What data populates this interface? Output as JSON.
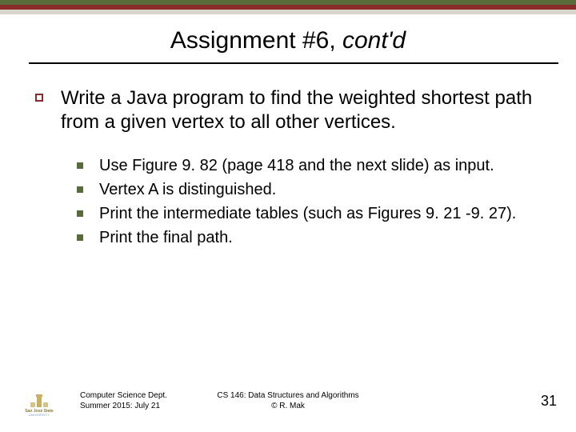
{
  "title": {
    "prefix": "Assignment #6, ",
    "emph": "cont'd"
  },
  "main": {
    "text": "Write a Java program to find the weighted shortest path from a given vertex to all other vertices."
  },
  "subs": [
    "Use Figure 9. 82 (page 418 and the next slide) as input.",
    "Vertex A is distinguished.",
    "Print the intermediate tables (such as Figures 9. 21 -9. 27).",
    "Print the final path."
  ],
  "footer": {
    "left_line1": "Computer Science Dept.",
    "left_line2": "Summer 2015: July 21",
    "center_line1": "CS 146: Data Structures and Algorithms",
    "center_line2": "© R. Mak",
    "page": "31",
    "logo_name": "San José State",
    "logo_sub": "UNIVERSITY"
  }
}
